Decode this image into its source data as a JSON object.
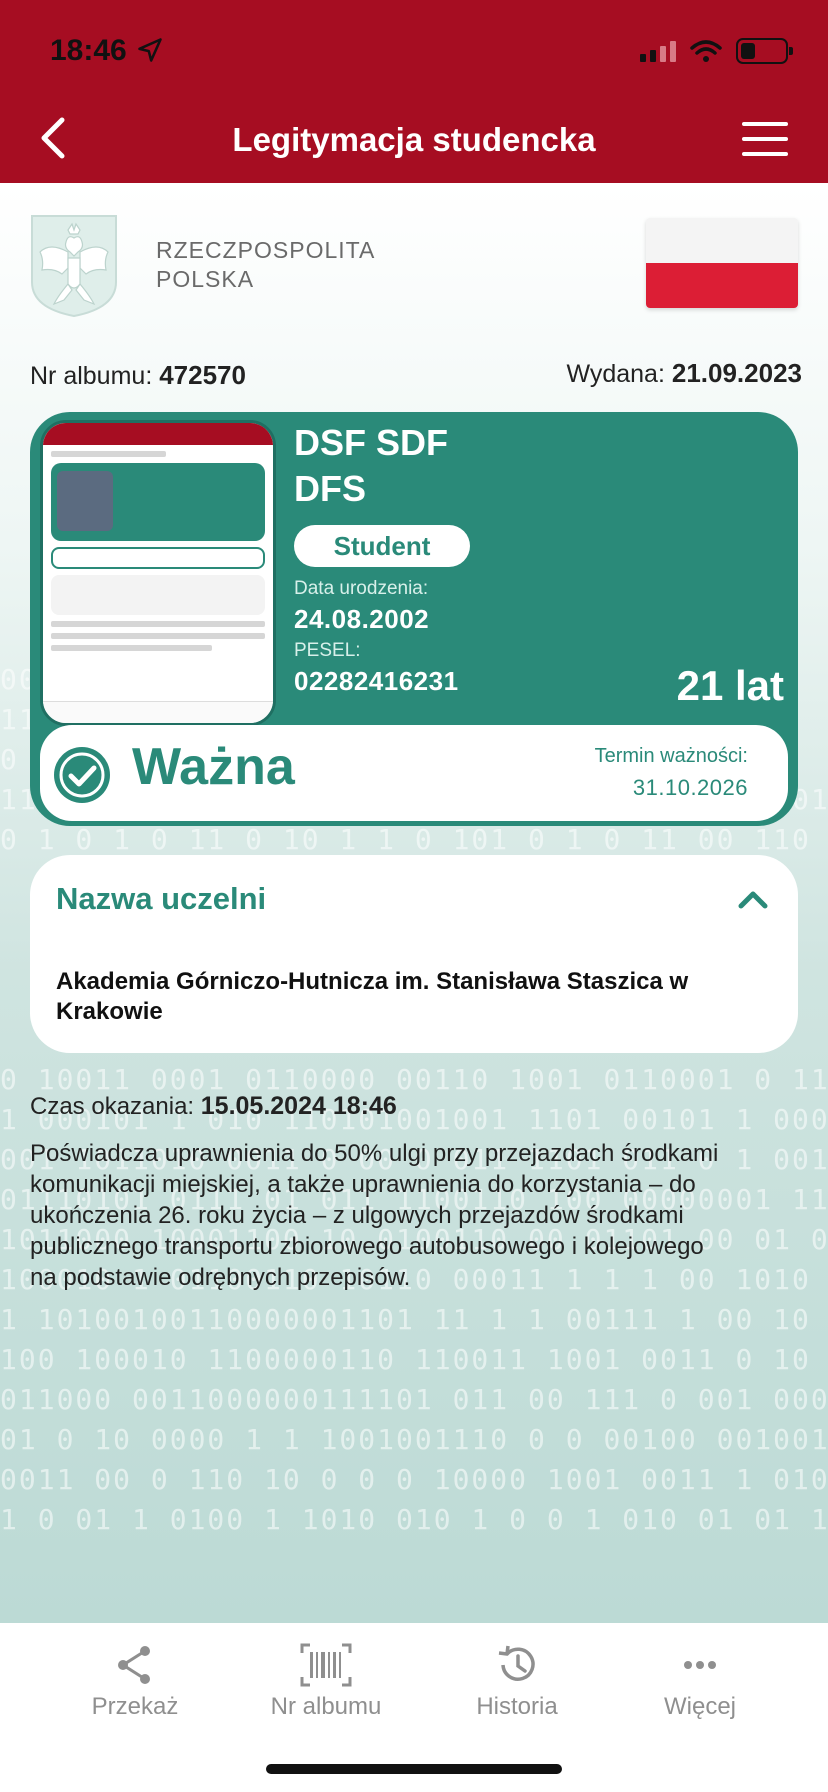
{
  "status_bar": {
    "time": "18:46"
  },
  "header": {
    "title": "Legitymacja studencka"
  },
  "country": {
    "line1": "RZECZPOSPOLITA",
    "line2": "POLSKA"
  },
  "album": {
    "label": "Nr albumu:",
    "value": "472570"
  },
  "issued": {
    "label": "Wydana:",
    "value": "21.09.2023"
  },
  "card": {
    "name_line1": "DSF SDF",
    "name_line2": "DFS",
    "badge": "Student",
    "birth_label": "Data urodzenia:",
    "birth_value": "24.08.2002",
    "pesel_label": "PESEL:",
    "pesel_value": "02282416231",
    "age": "21 lat",
    "valid_text": "Ważna",
    "valid_until_label": "Termin ważności:",
    "valid_until_value": "31.10.2026",
    "accent_color": "#2a8a79"
  },
  "university": {
    "title": "Nazwa uczelni",
    "name": "Akademia Górniczo-Hutnicza im. Stanisława Staszica w Krakowie"
  },
  "shown_at": {
    "label": "Czas okazania:",
    "value": "15.05.2024 18:46"
  },
  "description": "Poświadcza uprawnienia do 50% ulgi przy przejazdach środkami komunikacji miejskiej, a także uprawnienia do korzystania – do ukończenia 26. roku życia – z ulgowych przejazdów środkami publicznego transportu zbiorowego autobusowego i kolejowego na podstawie odrębnych przepisów.",
  "tabbar": {
    "share": {
      "label": "Przekaż",
      "icon": "share-icon"
    },
    "album": {
      "label": "Nr albumu",
      "icon": "barcode-icon"
    },
    "history": {
      "label": "Historia",
      "icon": "history-icon"
    },
    "more": {
      "label": "Więcej",
      "icon": "more-icon"
    }
  },
  "colors": {
    "header": "#a60d22",
    "accent": "#2a8a79"
  }
}
